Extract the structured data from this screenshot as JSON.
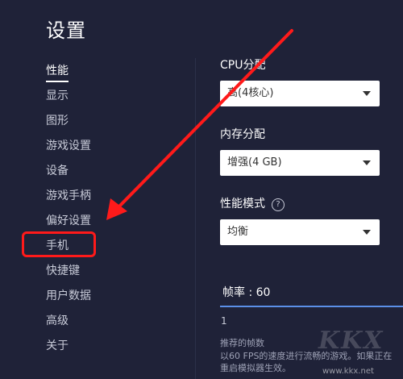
{
  "window": {
    "title": "设置"
  },
  "sidebar": {
    "items": [
      {
        "label": "性能",
        "active": true
      },
      {
        "label": "显示",
        "active": false
      },
      {
        "label": "图形",
        "active": false
      },
      {
        "label": "游戏设置",
        "active": false
      },
      {
        "label": "设备",
        "active": false
      },
      {
        "label": "游戏手柄",
        "active": false
      },
      {
        "label": "偏好设置",
        "active": false
      },
      {
        "label": "手机",
        "active": false
      },
      {
        "label": "快捷键",
        "active": false
      },
      {
        "label": "用户数据",
        "active": false
      },
      {
        "label": "高级",
        "active": false
      },
      {
        "label": "关于",
        "active": false
      }
    ]
  },
  "performance": {
    "cpu": {
      "label": "CPU分配",
      "value": "高(4核心)"
    },
    "memory": {
      "label": "内存分配",
      "value": "增强(4 GB)"
    },
    "mode": {
      "label": "性能模式",
      "help": "?",
      "value": "均衡"
    },
    "fps": {
      "label": "帧率 : 60",
      "min": "1",
      "value": 60,
      "fraction": 1.0,
      "hint_title": "推荐的帧数",
      "hint_body_1": "以60 FPS的速度进行流畅的游戏。如果正在",
      "hint_body_2": "重启模拟器生效。"
    }
  },
  "watermark": {
    "logo": "KKX",
    "url": "www.kkx.net"
  },
  "colors": {
    "background": "#1f2238",
    "annotation": "#ff1a1a",
    "slider": "#5b8fe8"
  }
}
